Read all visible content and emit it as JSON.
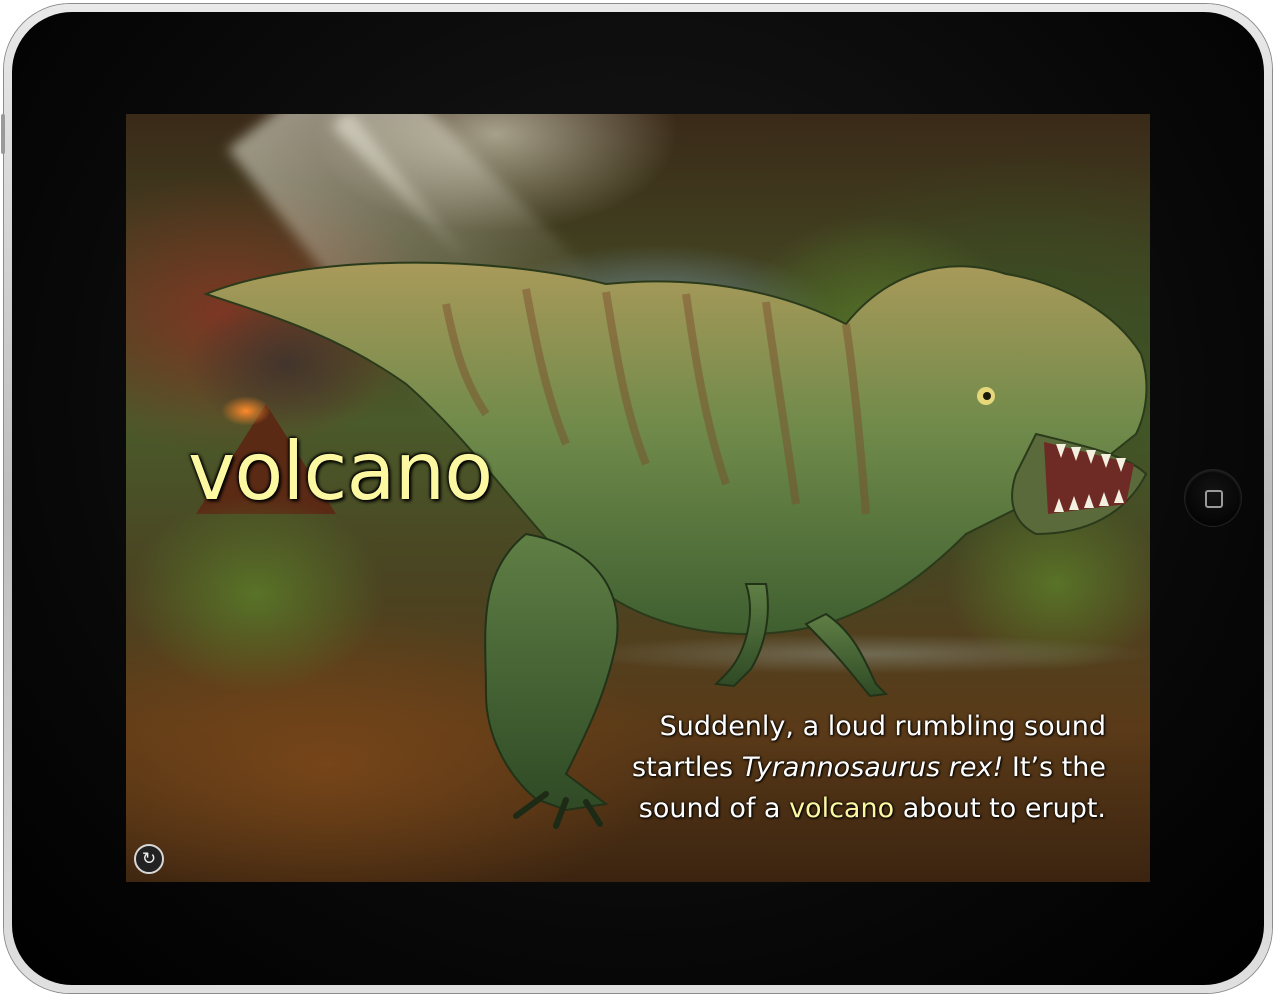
{
  "page": {
    "headline": "volcano",
    "story": {
      "line1": "Suddenly, a loud rumbling sound",
      "line2_before": "startles ",
      "line2_italic": "Tyrannosaurus rex!",
      "line2_after": " It’s the",
      "line3_before": "sound of a ",
      "line3_highlight": "volcano",
      "line3_after": " about to erupt."
    },
    "replay_icon": "replay-arrow-icon",
    "replay_glyph": "↻"
  },
  "colors": {
    "highlight": "#fcf8a2",
    "text": "#ffffff",
    "bezel": "#0a0a0a",
    "frame": "#c8c8c8"
  }
}
